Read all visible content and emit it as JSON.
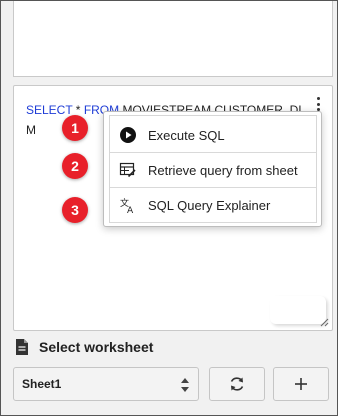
{
  "editor": {
    "sql_keyword_select": "SELECT",
    "sql_star": " * ",
    "sql_keyword_from": "FROM",
    "sql_table_line1": " MOVIESTREAM.CUSTOMER_DI",
    "sql_table_line2": "M"
  },
  "context_menu": {
    "items": [
      {
        "label": "Execute SQL",
        "icon": "play-circle-icon"
      },
      {
        "label": "Retrieve query from sheet",
        "icon": "sheet-edit-icon"
      },
      {
        "label": "SQL Query Explainer",
        "icon": "translate-icon"
      }
    ]
  },
  "callouts": [
    "1",
    "2",
    "3"
  ],
  "worksheet": {
    "header": "Select worksheet",
    "selected": "Sheet1"
  },
  "colors": {
    "keyword": "#1e3cd6",
    "badge": "#e8202a"
  }
}
